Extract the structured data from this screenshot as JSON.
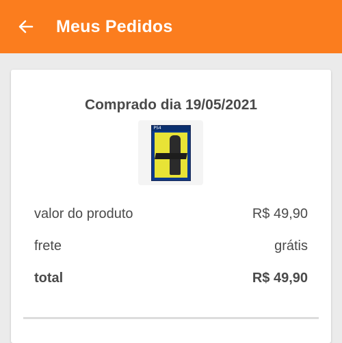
{
  "header": {
    "title": "Meus Pedidos",
    "back_icon": "arrow-left-icon",
    "background_color": "#fb7d1e"
  },
  "order": {
    "purchase_date": "Comprado dia 19/05/2021",
    "product_image": {
      "icon": "game-box-cover-image",
      "badge": "PS4"
    },
    "rows": [
      {
        "label": "valor do produto",
        "value": "R$ 49,90"
      },
      {
        "label": "frete",
        "value": "grátis"
      },
      {
        "label": "total",
        "value": "R$ 49,90"
      }
    ]
  }
}
